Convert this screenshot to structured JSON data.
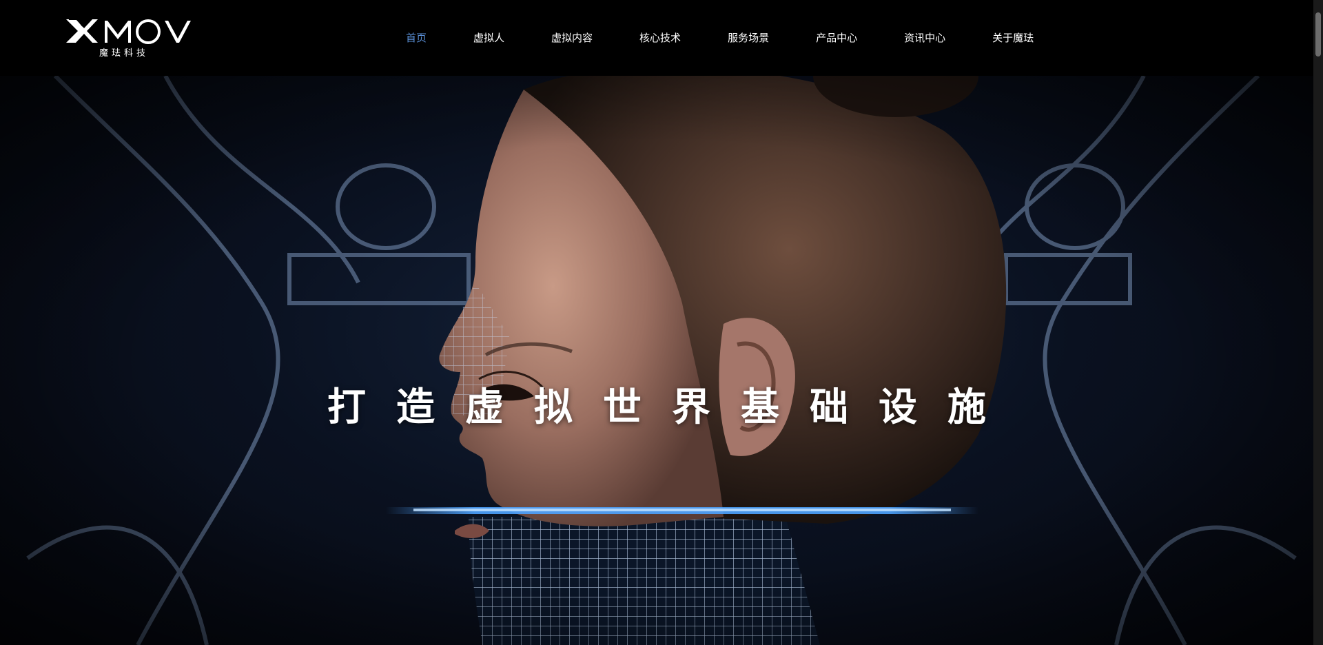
{
  "brand": {
    "logo_text": "XMOV",
    "logo_subtitle": "魔珐科技"
  },
  "nav": {
    "items": [
      {
        "label": "首页",
        "active": true
      },
      {
        "label": "虚拟人",
        "active": false
      },
      {
        "label": "虚拟内容",
        "active": false
      },
      {
        "label": "核心技术",
        "active": false
      },
      {
        "label": "服务场景",
        "active": false
      },
      {
        "label": "产品中心",
        "active": false
      },
      {
        "label": "资讯中心",
        "active": false
      },
      {
        "label": "关于魔珐",
        "active": false
      }
    ]
  },
  "hero": {
    "title": "打造虚拟世界基础设施",
    "image_subject": "digital-human-profile"
  },
  "colors": {
    "header_bg": "#000000",
    "nav_text": "#ffffff",
    "nav_active": "#5a8fd6",
    "scan_line": "#4da3ff",
    "hero_bg": "#0a1120"
  }
}
